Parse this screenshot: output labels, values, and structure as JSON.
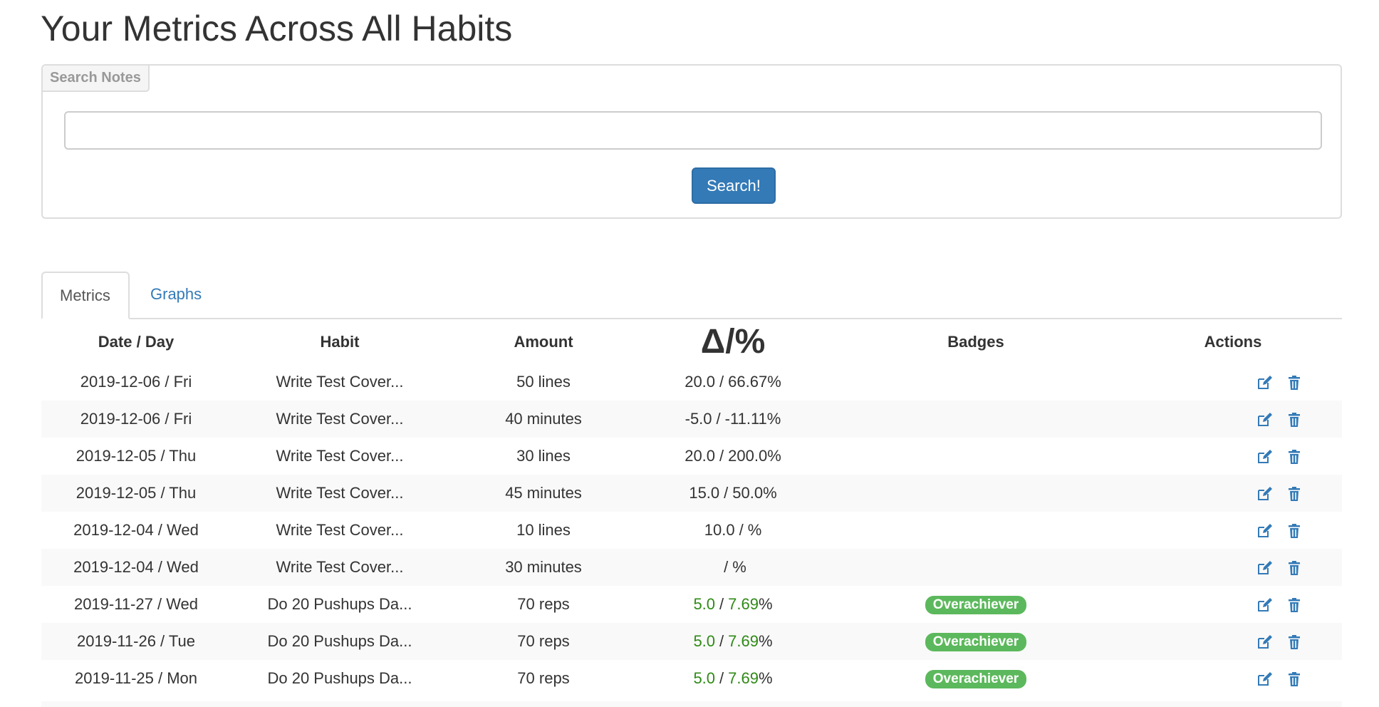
{
  "page": {
    "title": "Your Metrics Across All Habits"
  },
  "search": {
    "legend": "Search Notes",
    "value": "",
    "button_label": "Search!"
  },
  "tabs": [
    {
      "label": "Metrics",
      "active": true
    },
    {
      "label": "Graphs",
      "active": false
    }
  ],
  "table": {
    "columns": [
      "Date / Day",
      "Habit",
      "Amount",
      "Badges",
      "Actions"
    ],
    "delta_header": {
      "delta": "Δ",
      "slash": "/",
      "percent": "%"
    },
    "rows": [
      {
        "date": "2019-12-06 / Fri",
        "habit": "Write Test Cover...",
        "amount": "50 lines",
        "delta": "20.0",
        "percent": "66.67",
        "badge": "",
        "positive": false
      },
      {
        "date": "2019-12-06 / Fri",
        "habit": "Write Test Cover...",
        "amount": "40 minutes",
        "delta": "-5.0",
        "percent": "-11.11",
        "badge": "",
        "positive": false
      },
      {
        "date": "2019-12-05 / Thu",
        "habit": "Write Test Cover...",
        "amount": "30 lines",
        "delta": "20.0",
        "percent": "200.0",
        "badge": "",
        "positive": false
      },
      {
        "date": "2019-12-05 / Thu",
        "habit": "Write Test Cover...",
        "amount": "45 minutes",
        "delta": "15.0",
        "percent": "50.0",
        "badge": "",
        "positive": false
      },
      {
        "date": "2019-12-04 / Wed",
        "habit": "Write Test Cover...",
        "amount": "10 lines",
        "delta": "10.0",
        "percent": "",
        "badge": "",
        "positive": false
      },
      {
        "date": "2019-12-04 / Wed",
        "habit": "Write Test Cover...",
        "amount": "30 minutes",
        "delta": "",
        "percent": "",
        "badge": "",
        "positive": false
      },
      {
        "date": "2019-11-27 / Wed",
        "habit": "Do 20 Pushups Da...",
        "amount": "70 reps",
        "delta": "5.0",
        "percent": "7.69",
        "badge": "Overachiever",
        "positive": true
      },
      {
        "date": "2019-11-26 / Tue",
        "habit": "Do 20 Pushups Da...",
        "amount": "70 reps",
        "delta": "5.0",
        "percent": "7.69",
        "badge": "Overachiever",
        "positive": true
      },
      {
        "date": "2019-11-25 / Mon",
        "habit": "Do 20 Pushups Da...",
        "amount": "70 reps",
        "delta": "5.0",
        "percent": "7.69",
        "badge": "Overachiever",
        "positive": true
      }
    ]
  },
  "icons": {
    "edit": "edit-icon",
    "delete": "trash-icon"
  },
  "colors": {
    "primary": "#337ab7",
    "success": "#5cb85c",
    "positive_text": "#2f8a16"
  }
}
